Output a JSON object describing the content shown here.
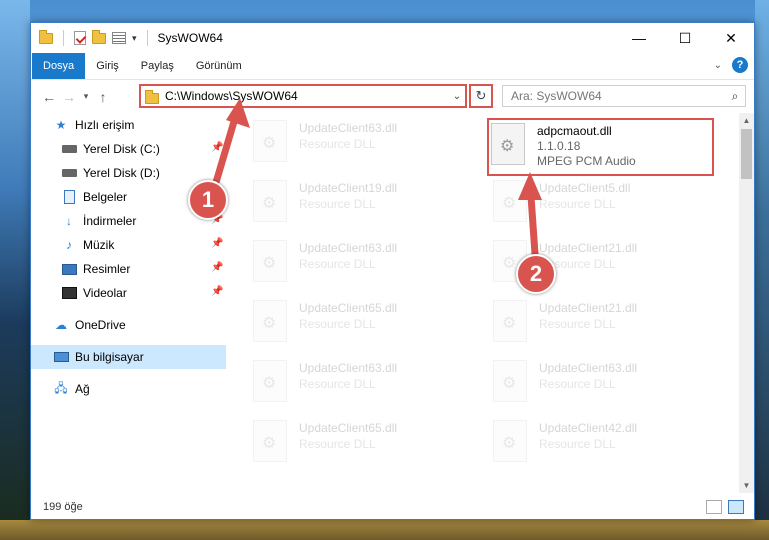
{
  "window": {
    "title": "SysWOW64",
    "controls": {
      "minimize": "—",
      "maximize": "☐",
      "close": "✕"
    }
  },
  "ribbon": {
    "tabs": [
      "Dosya",
      "Giriş",
      "Paylaş",
      "Görünüm"
    ],
    "help": "?"
  },
  "navigation": {
    "address": "C:\\Windows\\SysWOW64",
    "search_placeholder": "Ara: SysWOW64"
  },
  "sidebar": {
    "quick_access": "Hızlı erişim",
    "items": [
      {
        "label": "Yerel Disk (C:)",
        "icon": "drive-icon",
        "pinned": true
      },
      {
        "label": "Yerel Disk (D:)",
        "icon": "drive-icon",
        "pinned": false
      },
      {
        "label": "Belgeler",
        "icon": "documents-icon",
        "pinned": true
      },
      {
        "label": "İndirmeler",
        "icon": "downloads-icon",
        "pinned": true
      },
      {
        "label": "Müzik",
        "icon": "music-icon",
        "pinned": true
      },
      {
        "label": "Resimler",
        "icon": "pictures-icon",
        "pinned": true
      },
      {
        "label": "Videolar",
        "icon": "videos-icon",
        "pinned": true
      }
    ],
    "onedrive": "OneDrive",
    "this_pc": "Bu bilgisayar",
    "network": "Ağ"
  },
  "files": {
    "highlighted": {
      "name": "adpcmaout.dll",
      "version": "1.1.0.18",
      "description": "MPEG PCM Audio"
    },
    "left_column": [
      {
        "name": "UpdateClient63.dll",
        "type": "Resource DLL"
      },
      {
        "name": "UpdateClient19.dll",
        "type": "Resource DLL"
      },
      {
        "name": "UpdateClient63.dll",
        "type": "Resource DLL"
      },
      {
        "name": "UpdateClient65.dll",
        "type": "Resource DLL"
      },
      {
        "name": "UpdateClient63.dll",
        "type": "Resource DLL"
      },
      {
        "name": "UpdateClient65.dll",
        "type": "Resource DLL"
      }
    ],
    "right_column": [
      {
        "name": "UpdateClient5.dll",
        "type": "Resource DLL"
      },
      {
        "name": "UpdateClient21.dll",
        "type": "Resource DLL"
      },
      {
        "name": "UpdateClient21.dll",
        "type": "Resource DLL"
      },
      {
        "name": "UpdateClient63.dll",
        "type": "Resource DLL"
      },
      {
        "name": "UpdateClient42.dll",
        "type": "Resource DLL"
      }
    ]
  },
  "status": {
    "item_count": "199 öğe"
  },
  "annotations": {
    "badge1": "1",
    "badge2": "2",
    "color": "#d9534f"
  }
}
